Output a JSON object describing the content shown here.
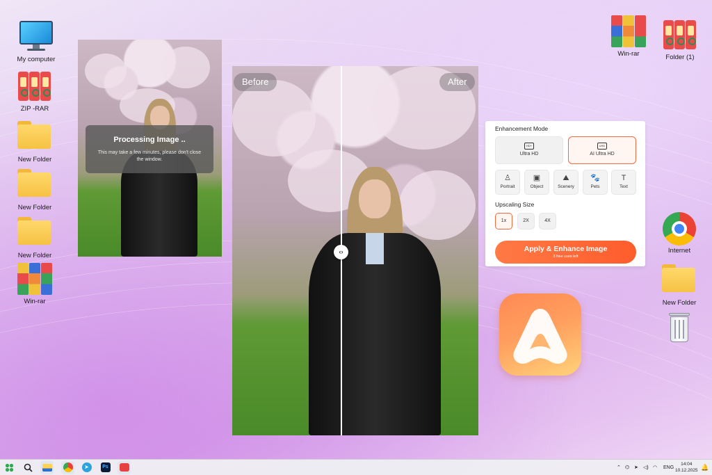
{
  "desktop": {
    "icons_left": [
      {
        "label": "My computer",
        "icon": "monitor-icon"
      },
      {
        "label": "ZIP -RAR",
        "icon": "binders-icon"
      },
      {
        "label": "New Folder",
        "icon": "folder-icon"
      },
      {
        "label": "New Folder",
        "icon": "folder-icon"
      },
      {
        "label": "New Folder",
        "icon": "folder-icon"
      },
      {
        "label": "Win-rar",
        "icon": "winrar-icon"
      }
    ],
    "icons_right": [
      {
        "label": "Win-rar",
        "icon": "winrar-icon"
      },
      {
        "label": "Folder (1)",
        "icon": "binders-icon"
      },
      {
        "label": "Internet",
        "icon": "chrome-icon"
      },
      {
        "label": "New Folder",
        "icon": "folder-icon"
      },
      {
        "label": "",
        "icon": "recycle-bin-icon"
      }
    ]
  },
  "processing": {
    "title": "Processing Image ..",
    "subtitle": "This may take a few minutes, please don't close the window."
  },
  "compare": {
    "before_label": "Before",
    "after_label": "After",
    "handle_glyph": "‹›"
  },
  "enhance_panel": {
    "mode_heading": "Enhancement Mode",
    "modes": [
      {
        "label": "Ultra HD",
        "badge": "HD+",
        "selected": false
      },
      {
        "label": "AI Ultra HD",
        "badge": "UHD",
        "selected": true
      }
    ],
    "categories": [
      {
        "label": "Portrait",
        "icon": "portrait-icon",
        "glyph": "♙"
      },
      {
        "label": "Object",
        "icon": "object-icon",
        "glyph": "▣"
      },
      {
        "label": "Scenery",
        "icon": "scenery-icon",
        "glyph": "⛰"
      },
      {
        "label": "Pets",
        "icon": "pets-icon",
        "glyph": "🐾"
      },
      {
        "label": "Text",
        "icon": "text-icon",
        "glyph": "T"
      }
    ],
    "size_heading": "Upscaling Size",
    "sizes": [
      {
        "label": "1x",
        "selected": true
      },
      {
        "label": "2X",
        "selected": false
      },
      {
        "label": "4X",
        "selected": false
      }
    ],
    "apply_label": "Apply & Enhance Image",
    "uses_left": "3 free uses left"
  },
  "taskbar": {
    "language": "ENG",
    "time": "14:04",
    "date": "10.12.2025"
  },
  "colors": {
    "accent": "#ff6a36",
    "panel_bg": "#ffffff"
  }
}
